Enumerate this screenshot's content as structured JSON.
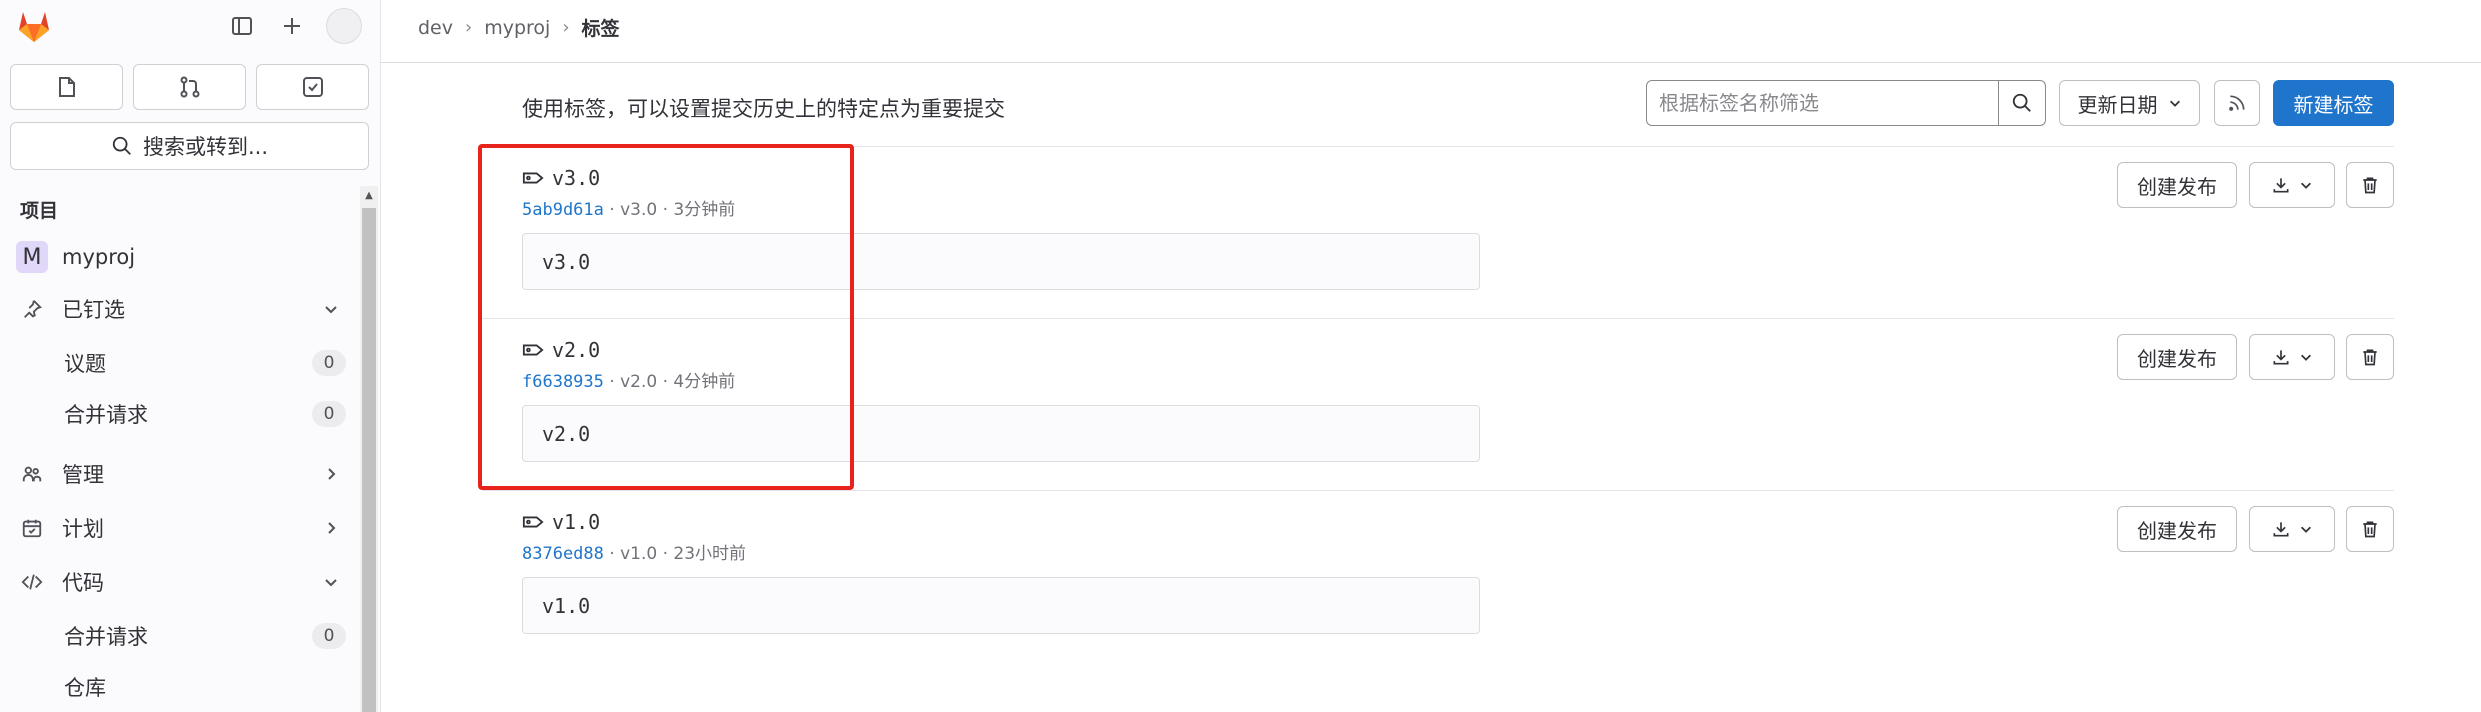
{
  "sidebar": {
    "project_section_title": "项目",
    "search_label": "搜索或转到...",
    "project": {
      "initial": "M",
      "name": "myproj"
    },
    "pinned": {
      "label": "已钉选",
      "items": [
        {
          "label": "议题",
          "count": "0"
        },
        {
          "label": "合并请求",
          "count": "0"
        }
      ]
    },
    "manage_label": "管理",
    "plan_label": "计划",
    "code": {
      "label": "代码",
      "items": [
        {
          "label": "合并请求",
          "count": "0"
        },
        {
          "label": "仓库"
        }
      ]
    }
  },
  "breadcrumb": {
    "group": "dev",
    "project": "myproj",
    "current": "标签"
  },
  "main": {
    "intro": "使用标签，可以设置提交历史上的特定点为重要提交",
    "filter_placeholder": "根据标签名称筛选",
    "sort_label": "更新日期",
    "new_tag_label": "新建标签",
    "release_button_label": "创建发布",
    "tags": [
      {
        "name": "v3.0",
        "sha": "5ab9d61a",
        "meta": " · v3.0 · 3分钟前",
        "message": "v3.0"
      },
      {
        "name": "v2.0",
        "sha": "f6638935",
        "meta": " · v2.0 · 4分钟前",
        "message": "v2.0"
      },
      {
        "name": "v1.0",
        "sha": "8376ed88",
        "meta": " · v1.0 · 23小时前",
        "message": "v1.0"
      }
    ]
  },
  "colors": {
    "primary": "#1f75cb",
    "highlight": "#e8231b",
    "logo": "#e24329"
  },
  "icons": [
    "gitlab-logo",
    "sidebar-toggle-icon",
    "plus-icon",
    "issues-icon",
    "merge-request-icon",
    "todo-icon",
    "search-icon",
    "pin-icon",
    "users-icon",
    "calendar-icon",
    "code-icon",
    "chevron-down-icon",
    "chevron-right-icon",
    "tag-icon",
    "rss-icon",
    "download-icon",
    "trash-icon"
  ]
}
